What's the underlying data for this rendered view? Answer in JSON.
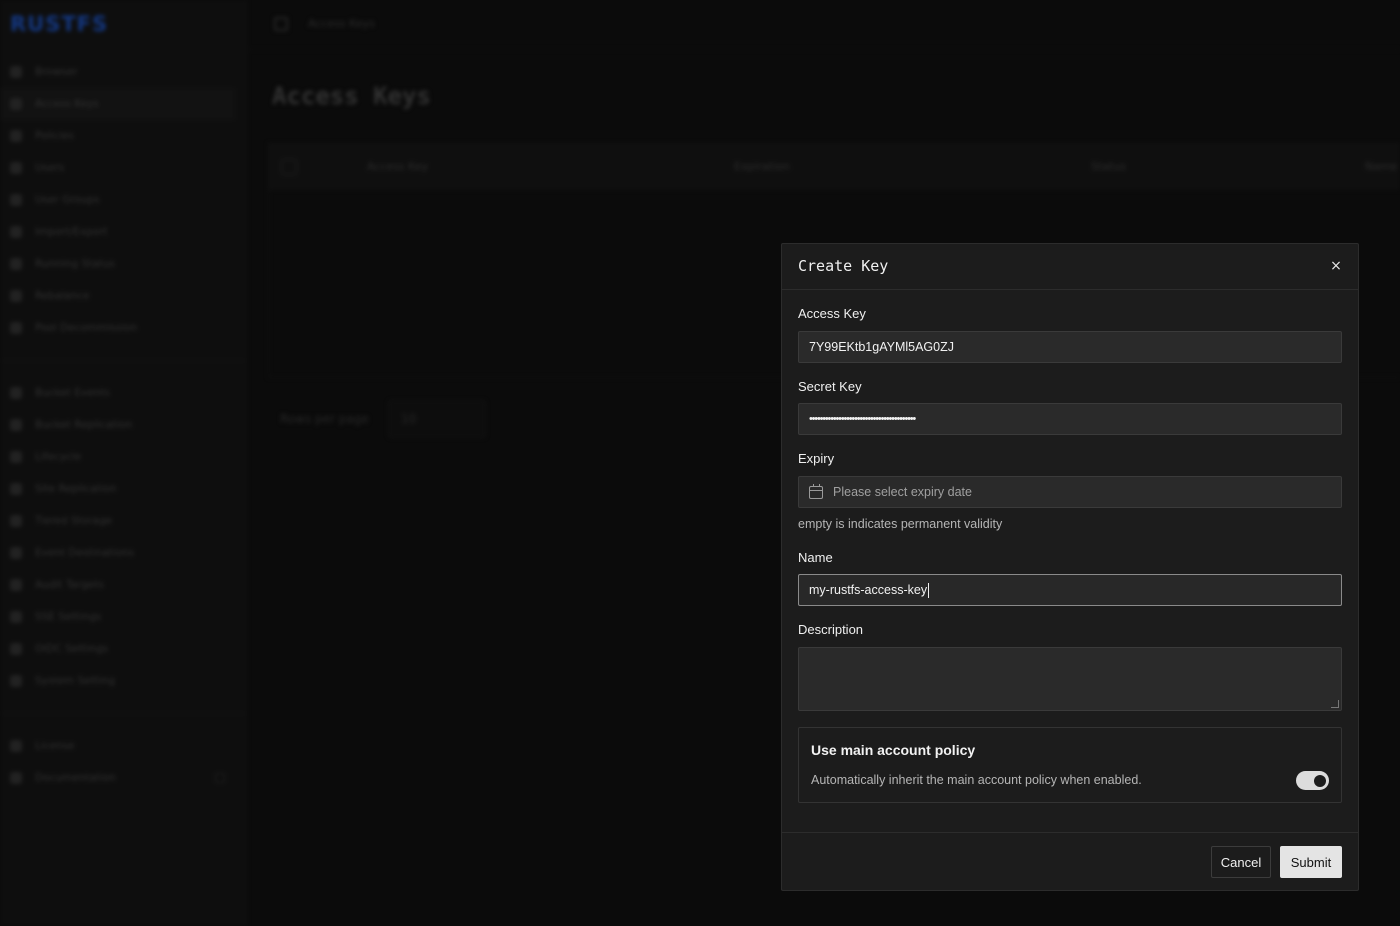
{
  "app": {
    "logo": "RUSTFS",
    "breadcrumb": "Access Keys",
    "page_title": "Access Keys",
    "sidebar": {
      "group1": [
        {
          "label": "Browser"
        },
        {
          "label": "Access Keys",
          "active": true
        },
        {
          "label": "Policies"
        },
        {
          "label": "Users"
        },
        {
          "label": "User Groups"
        },
        {
          "label": "Import/Export"
        },
        {
          "label": "Running Status"
        },
        {
          "label": "Rebalance"
        },
        {
          "label": "Pool Decommission"
        }
      ],
      "group2": [
        {
          "label": "Bucket Events"
        },
        {
          "label": "Bucket Replication"
        },
        {
          "label": "Lifecycle"
        },
        {
          "label": "Site Replication"
        },
        {
          "label": "Tiered Storage"
        },
        {
          "label": "Event Destinations"
        },
        {
          "label": "Audit Targets"
        },
        {
          "label": "SSE Settings"
        },
        {
          "label": "OIDC Settings"
        },
        {
          "label": "System Setting"
        }
      ],
      "group3": [
        {
          "label": "License"
        },
        {
          "label": "Documentation"
        }
      ]
    },
    "table": {
      "columns": [
        "Access Key",
        "Expiration",
        "Status",
        "Name"
      ]
    },
    "pagination": {
      "rows_per_page_label": "Rows per page",
      "rows_per_page_value": "10"
    }
  },
  "modal": {
    "title": "Create Key",
    "close_icon": "×",
    "fields": {
      "access_key": {
        "label": "Access Key",
        "value": "7Y99EKtb1gAYMl5AG0ZJ"
      },
      "secret_key": {
        "label": "Secret Key",
        "value": "••••••••••••••••••••••••••••••••••••••••"
      },
      "expiry": {
        "label": "Expiry",
        "placeholder": "Please select expiry date",
        "hint": "empty is indicates permanent validity"
      },
      "name": {
        "label": "Name",
        "value": "my-rustfs-access-key"
      },
      "description": {
        "label": "Description",
        "value": ""
      }
    },
    "policy": {
      "title": "Use main account policy",
      "description": "Automatically inherit the main account policy when enabled.",
      "enabled": true
    },
    "buttons": {
      "cancel": "Cancel",
      "submit": "Submit"
    }
  }
}
